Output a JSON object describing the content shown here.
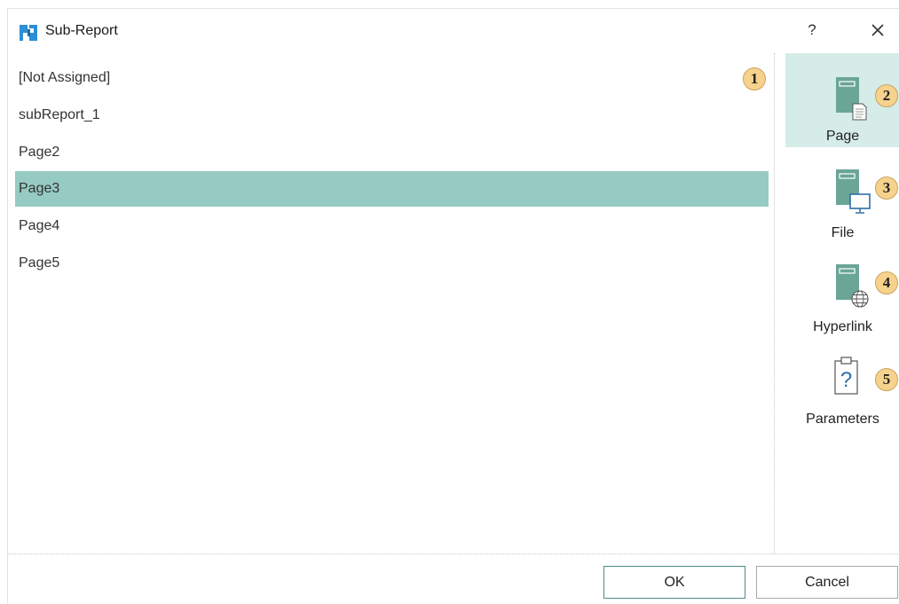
{
  "window": {
    "title": "Sub-Report",
    "help_label": "?"
  },
  "list": {
    "items": [
      "[Not Assigned]",
      "subReport_1",
      "Page2",
      "Page3",
      "Page4",
      "Page5"
    ],
    "selected": "Page3"
  },
  "callouts": [
    "1",
    "2",
    "3",
    "4",
    "5"
  ],
  "sidebar": {
    "page_label": "Page",
    "file_label": "File",
    "hyperlink_label": "Hyperlink",
    "parameters_label": "Parameters"
  },
  "footer": {
    "ok_label": "OK",
    "cancel_label": "Cancel"
  },
  "colors": {
    "selection": "#96cbc3",
    "active_tab": "#d5ece8",
    "icon_green": "#6aa596",
    "callout": "#f7d28c",
    "brand_blue": "#2d8fd5"
  }
}
